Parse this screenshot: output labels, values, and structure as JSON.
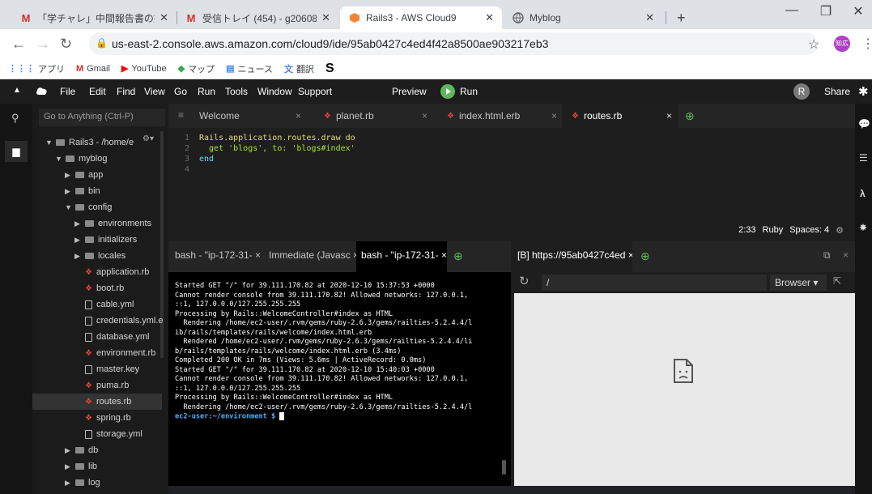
{
  "browser": {
    "tabs": [
      {
        "icon": "M",
        "title": "「学チャレ」中間報告書の提出につい",
        "active": false
      },
      {
        "icon": "M",
        "title": "受信トレイ (454) - g206084@hi-te",
        "active": false
      },
      {
        "icon": "cube",
        "title": "Rails3 - AWS Cloud9",
        "active": true
      },
      {
        "icon": "globe",
        "title": "Myblog",
        "active": false
      }
    ],
    "new_tab": "+",
    "url": "us-east-2.console.aws.amazon.com/cloud9/ide/95ab0427c4ed4f42a8500ae903217eb3",
    "profile": "知広",
    "bookmarks": [
      {
        "icon": "apps",
        "label": "アプリ"
      },
      {
        "icon": "gmail",
        "label": "Gmail"
      },
      {
        "icon": "youtube",
        "label": "YouTube"
      },
      {
        "icon": "maps",
        "label": "マップ"
      },
      {
        "icon": "news",
        "label": "ニュース"
      },
      {
        "icon": "translate",
        "label": "翻訳"
      },
      {
        "icon": "S",
        "label": ""
      }
    ]
  },
  "c9menu": {
    "items": [
      "File",
      "Edit",
      "Find",
      "View",
      "Go",
      "Run",
      "Tools",
      "Window",
      "Support"
    ],
    "preview": "Preview",
    "run": "Run",
    "avatar": "R",
    "share": "Share"
  },
  "tree": {
    "goto": "Go to Anything (Ctrl-P)",
    "items": [
      {
        "label": "Rails3 - /home/e",
        "type": "folder",
        "depth": 0,
        "open": true
      },
      {
        "label": "myblog",
        "type": "folder",
        "depth": 1,
        "open": true
      },
      {
        "label": "app",
        "type": "folder",
        "depth": 2,
        "open": false
      },
      {
        "label": "bin",
        "type": "folder",
        "depth": 2,
        "open": false
      },
      {
        "label": "config",
        "type": "folder",
        "depth": 2,
        "open": true
      },
      {
        "label": "environments",
        "type": "folder",
        "depth": 3,
        "open": false
      },
      {
        "label": "initializers",
        "type": "folder",
        "depth": 3,
        "open": false
      },
      {
        "label": "locales",
        "type": "folder",
        "depth": 3,
        "open": false
      },
      {
        "label": "application.rb",
        "type": "ruby",
        "depth": 3
      },
      {
        "label": "boot.rb",
        "type": "ruby",
        "depth": 3
      },
      {
        "label": "cable.yml",
        "type": "doc",
        "depth": 3
      },
      {
        "label": "credentials.yml.e",
        "type": "doc",
        "depth": 3
      },
      {
        "label": "database.yml",
        "type": "doc",
        "depth": 3
      },
      {
        "label": "environment.rb",
        "type": "ruby",
        "depth": 3
      },
      {
        "label": "master.key",
        "type": "doc",
        "depth": 3
      },
      {
        "label": "puma.rb",
        "type": "ruby",
        "depth": 3
      },
      {
        "label": "routes.rb",
        "type": "ruby",
        "depth": 3,
        "selected": true
      },
      {
        "label": "spring.rb",
        "type": "ruby",
        "depth": 3
      },
      {
        "label": "storage.yml",
        "type": "doc",
        "depth": 3
      },
      {
        "label": "db",
        "type": "folder",
        "depth": 2,
        "open": false
      },
      {
        "label": "lib",
        "type": "folder",
        "depth": 2,
        "open": false
      },
      {
        "label": "log",
        "type": "folder",
        "depth": 2,
        "open": false
      }
    ]
  },
  "editor": {
    "tabs": [
      {
        "label": "Welcome",
        "icon": "none",
        "active": false
      },
      {
        "label": "planet.rb",
        "icon": "ruby",
        "active": false
      },
      {
        "label": "index.html.erb",
        "icon": "ruby",
        "active": false
      },
      {
        "label": "routes.rb",
        "icon": "ruby",
        "active": true
      }
    ],
    "lines": [
      {
        "n": "1",
        "text": "Rails.application.routes.draw do"
      },
      {
        "n": "2",
        "text": "  get 'blogs', to: 'blogs#index'"
      },
      {
        "n": "3",
        "text": "end"
      },
      {
        "n": "4",
        "text": ""
      }
    ],
    "status": {
      "pos": "2:33",
      "lang": "Ruby",
      "spaces": "Spaces: 4"
    }
  },
  "terminal": {
    "tabs": [
      {
        "label": "bash - \"ip-172-31-",
        "active": false
      },
      {
        "label": "Immediate (Javasc",
        "active": false
      },
      {
        "label": "bash - \"ip-172-31-",
        "active": true
      }
    ],
    "lines": [
      "Started GET \"/\" for 39.111.170.82 at 2020-12-10 15:37:53 +0000",
      "Cannot render console from 39.111.170.82! Allowed networks: 127.0.0.1,",
      "::1, 127.0.0.0/127.255.255.255",
      "Processing by Rails::WelcomeController#index as HTML",
      "  Rendering /home/ec2-user/.rvm/gems/ruby-2.6.3/gems/railties-5.2.4.4/l",
      "ib/rails/templates/rails/welcome/index.html.erb",
      "  Rendered /home/ec2-user/.rvm/gems/ruby-2.6.3/gems/railties-5.2.4.4/li",
      "b/rails/templates/rails/welcome/index.html.erb (3.4ms)",
      "Completed 200 OK in 7ms (Views: 5.6ms | ActiveRecord: 0.0ms)",
      "",
      "",
      "Started GET \"/\" for 39.111.170.82 at 2020-12-10 15:40:03 +0000",
      "Cannot render console from 39.111.170.82! Allowed networks: 127.0.0.1,",
      "::1, 127.0.0.0/127.255.255.255",
      "Processing by Rails::WelcomeController#index as HTML",
      "  Rendering /home/ec2-user/.rvm/gems/ruby-2.6.3/gems/railties-5.2.4.4/l"
    ],
    "prompt_user": "ec2-user",
    "prompt_path": ":~/environment $"
  },
  "preview": {
    "tab": "[B] https://95ab0427c4ed",
    "path": "/",
    "browser_btn": "Browser"
  }
}
